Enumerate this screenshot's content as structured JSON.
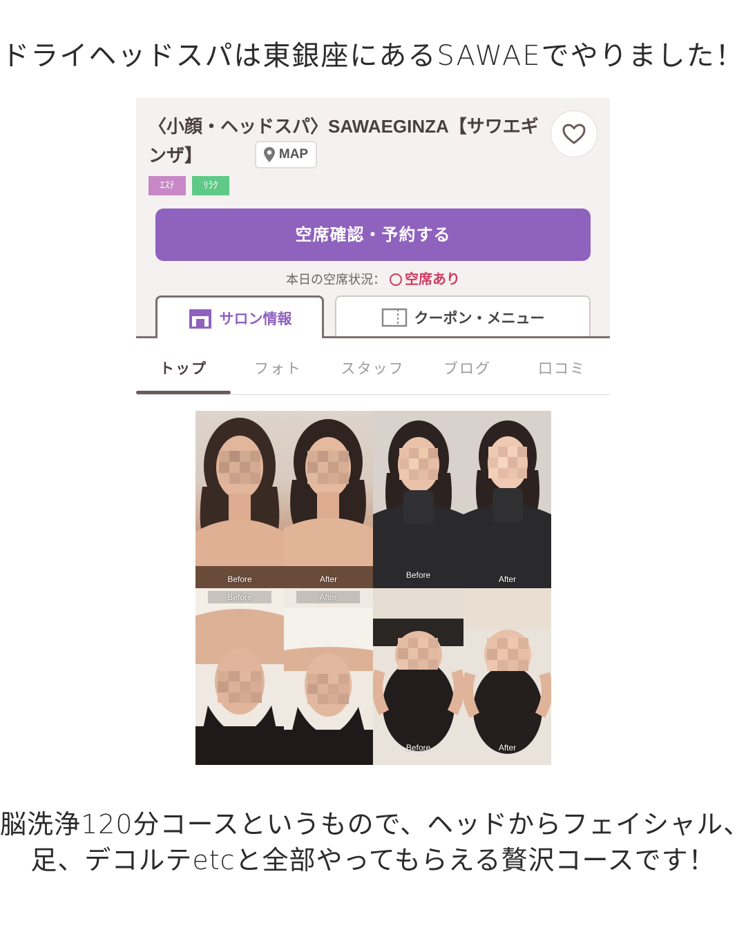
{
  "captions": {
    "top": "ドライヘッドスパは東銀座にあるSAWAEでやりました！",
    "bottom_line1": "脳洗浄120分コースというもので、ヘッドからフェイシャル、",
    "bottom_line2": "足、デコルテetcと全部やってもらえる贅沢コースです！"
  },
  "salon": {
    "title": "〈小顔・ヘッドスパ〉SAWAEGINZA【サワエギンザ】",
    "map_label": "MAP",
    "tags": [
      "ｴｽﾃ",
      "ﾘﾗｸ"
    ],
    "reserve_label": "空席確認・予約する",
    "availability_label": "本日の空席状況：",
    "availability_status": "空席あり",
    "tabs": {
      "salon_info": "サロン情報",
      "coupon_menu": "クーポン・メニュー"
    }
  },
  "subnav": {
    "items": [
      "トップ",
      "フォト",
      "スタッフ",
      "ブログ",
      "口コミ"
    ],
    "active": "トップ"
  },
  "photos": {
    "labels": [
      "Before",
      "After",
      "Before",
      "After",
      "Before",
      "After",
      "Before",
      "After"
    ]
  },
  "colors": {
    "accent_purple": "#8f62bd",
    "status_red": "#d23a62",
    "tag_este": "#c887c6",
    "tag_relax": "#5fc987"
  }
}
